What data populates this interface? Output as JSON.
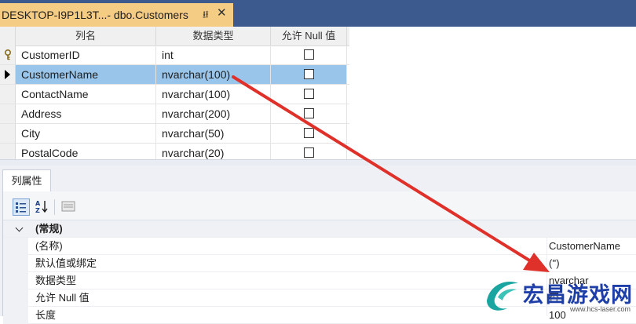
{
  "document_tab": {
    "title": "DESKTOP-I9P1L3T...- dbo.Customers"
  },
  "grid": {
    "headers": [
      "列名",
      "数据类型",
      "允许 Null 值"
    ],
    "rows": [
      {
        "name": "CustomerID",
        "type": "int",
        "primary_key": true,
        "selected": false
      },
      {
        "name": "CustomerName",
        "type": "nvarchar(100)",
        "primary_key": false,
        "selected": true
      },
      {
        "name": "ContactName",
        "type": "nvarchar(100)",
        "primary_key": false,
        "selected": false
      },
      {
        "name": "Address",
        "type": "nvarchar(200)",
        "primary_key": false,
        "selected": false
      },
      {
        "name": "City",
        "type": "nvarchar(50)",
        "primary_key": false,
        "selected": false
      },
      {
        "name": "PostalCode",
        "type": "nvarchar(20)",
        "primary_key": false,
        "selected": false
      }
    ]
  },
  "properties": {
    "tab_label": "列属性",
    "category": "(常规)",
    "rows": [
      {
        "label": "(名称)",
        "value": "CustomerName"
      },
      {
        "label": "默认值或绑定",
        "value": "('')"
      },
      {
        "label": "数据类型",
        "value": "nvarchar"
      },
      {
        "label": "允许 Null 值",
        "value": "否"
      },
      {
        "label": "长度",
        "value": "100"
      }
    ]
  },
  "watermark": {
    "text": "宏昌游戏网",
    "url": "www.hcs-laser.com"
  },
  "colors": {
    "tab_active": "#f5cc84",
    "tabstrip": "#3c5a8e",
    "selection": "#99c5ea",
    "annotation_arrow": "#e0302a"
  }
}
